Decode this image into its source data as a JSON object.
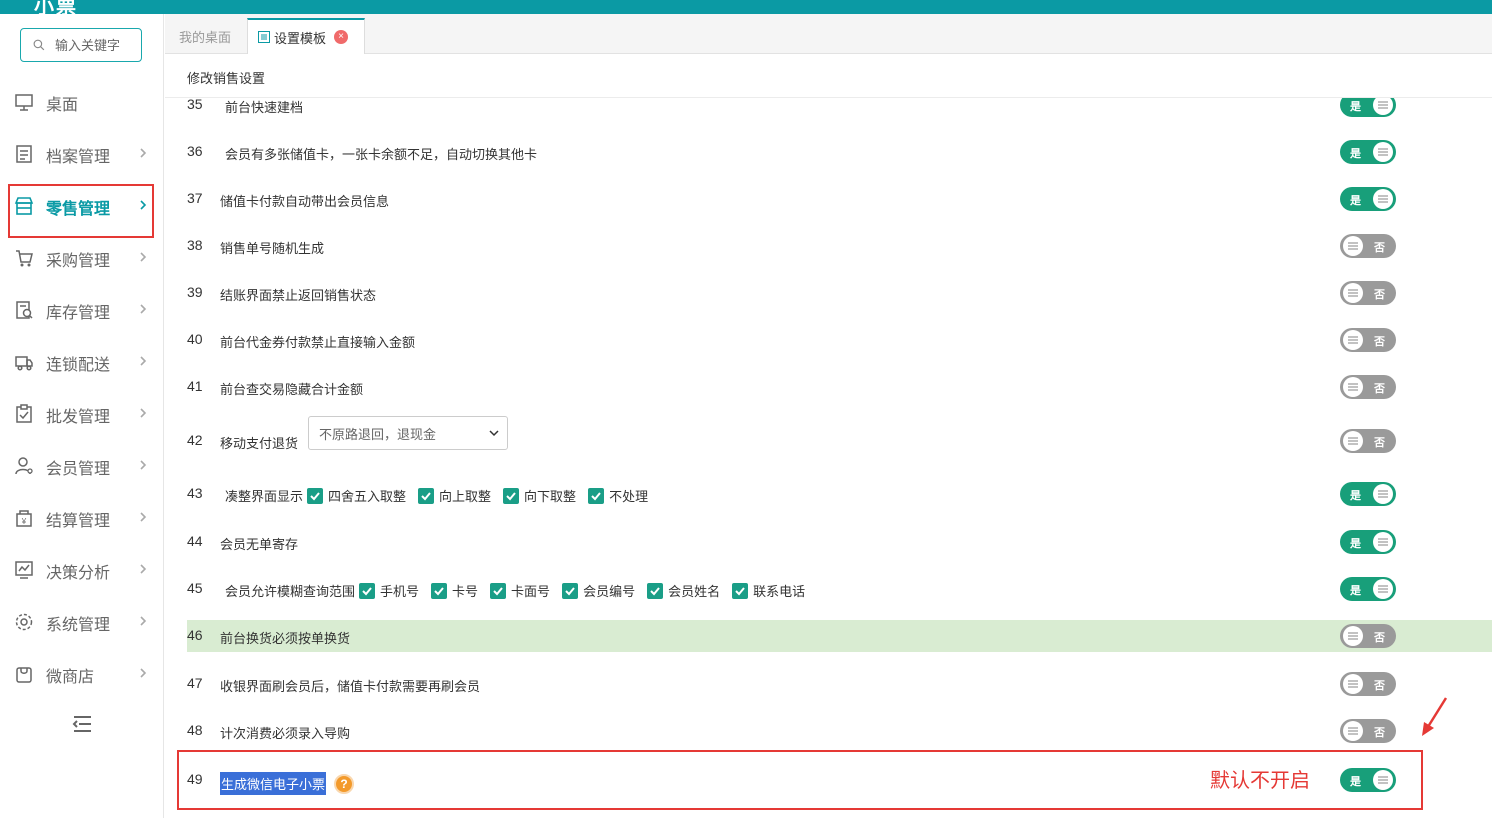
{
  "app": {
    "logo_text": "小票"
  },
  "search": {
    "placeholder": "输入关键字"
  },
  "sidebar": {
    "items": [
      {
        "label": "桌面",
        "icon": "desktop-icon"
      },
      {
        "label": "档案管理",
        "icon": "archive-icon"
      },
      {
        "label": "零售管理",
        "icon": "store-icon",
        "active": true
      },
      {
        "label": "采购管理",
        "icon": "cart-icon"
      },
      {
        "label": "库存管理",
        "icon": "inventory-icon"
      },
      {
        "label": "连锁配送",
        "icon": "truck-icon"
      },
      {
        "label": "批发管理",
        "icon": "wholesale-icon"
      },
      {
        "label": "会员管理",
        "icon": "member-icon"
      },
      {
        "label": "结算管理",
        "icon": "settlement-icon"
      },
      {
        "label": "决策分析",
        "icon": "analysis-icon"
      },
      {
        "label": "系统管理",
        "icon": "gear-icon"
      },
      {
        "label": "微商店",
        "icon": "shop-bag-icon"
      }
    ]
  },
  "tabs": {
    "home": "我的桌面",
    "current": "设置模板",
    "close": "×"
  },
  "panel": {
    "title": "修改销售设置"
  },
  "toggle_text": {
    "on": "是",
    "off": "否"
  },
  "rows": [
    {
      "num": "35",
      "label": "前台快速建档",
      "state": "on"
    },
    {
      "num": "36",
      "label": "会员有多张储值卡，一张卡余额不足，自动切换其他卡",
      "state": "on"
    },
    {
      "num": "37",
      "label": "储值卡付款自动带出会员信息",
      "state": "on"
    },
    {
      "num": "38",
      "label": "销售单号随机生成",
      "state": "off"
    },
    {
      "num": "39",
      "label": "结账界面禁止返回销售状态",
      "state": "off"
    },
    {
      "num": "40",
      "label": "前台代金券付款禁止直接输入金额",
      "state": "off"
    },
    {
      "num": "41",
      "label": "前台查交易隐藏合计金额",
      "state": "off"
    },
    {
      "num": "42",
      "label": "移动支付退货",
      "select": "不原路退回，退现金",
      "state": "off"
    },
    {
      "num": "43",
      "label": "凑整界面显示",
      "options": [
        "四舍五入取整",
        "向上取整",
        "向下取整",
        "不处理"
      ],
      "state": "on"
    },
    {
      "num": "44",
      "label": "会员无单寄存",
      "state": "on"
    },
    {
      "num": "45",
      "label": "会员允许模糊查询范围",
      "options": [
        "手机号",
        "卡号",
        "卡面号",
        "会员编号",
        "会员姓名",
        "联系电话"
      ],
      "state": "on"
    },
    {
      "num": "46",
      "label": "前台换货必须按单换货",
      "state": "off",
      "highlight": true
    },
    {
      "num": "47",
      "label": "收银界面刷会员后，储值卡付款需要再刷会员",
      "state": "off"
    },
    {
      "num": "48",
      "label": "计次消费必须录入导购",
      "state": "off"
    },
    {
      "num": "49",
      "label": "生成微信电子小票",
      "state": "on",
      "help": "?"
    }
  ],
  "annotation": {
    "note": "默认不开启",
    "color": "#e53935"
  },
  "colors": {
    "accent": "#0b9aa4",
    "toggle_on": "#189f7a",
    "toggle_off": "#9a9a9a",
    "highlight_row": "#d9ecd2"
  }
}
